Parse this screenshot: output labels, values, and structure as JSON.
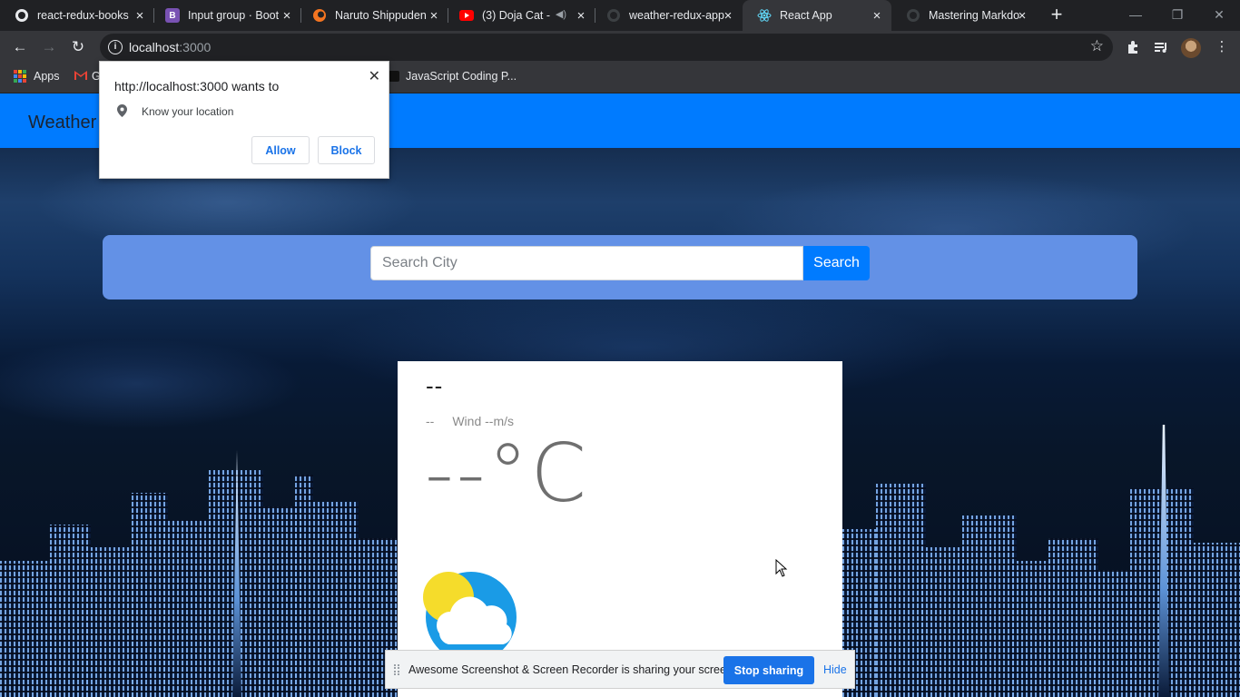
{
  "browser": {
    "tabs": [
      {
        "title": "react-redux-books",
        "icon": "github-icon"
      },
      {
        "title": "Input group · Boot",
        "icon": "bootstrap-icon"
      },
      {
        "title": "Naruto Shippuden",
        "icon": "crunchyroll-icon"
      },
      {
        "title": "(3) Doja Cat - ",
        "icon": "youtube-icon"
      },
      {
        "title": "weather-redux-app",
        "icon": "github-icon"
      },
      {
        "title": "React App",
        "icon": "react-icon",
        "active": true
      },
      {
        "title": "Mastering Markdo",
        "icon": "github-icon"
      }
    ],
    "address": {
      "host": "localhost",
      "port": ":3000"
    },
    "bookmarks": {
      "apps": "Apps",
      "gmail": "G",
      "javascript": "JavaScript Coding P..."
    }
  },
  "permission": {
    "title": "http://localhost:3000 wants to",
    "request": "Know your location",
    "allow": "Allow",
    "block": "Block"
  },
  "app": {
    "brand": "Weather",
    "search": {
      "placeholder": "Search City",
      "button": "Search"
    },
    "card": {
      "city": "--",
      "description": "--",
      "wind": "Wind --m/s",
      "temperature": "--°C",
      "icon": "partly-cloudy-icon"
    }
  },
  "sharing": {
    "message": "Awesome Screenshot & Screen Recorder is sharing your screen.",
    "stop": "Stop sharing",
    "hide": "Hide"
  },
  "colors": {
    "navbar": "#007bff",
    "searchbar": "#6391e6",
    "chrome_dark": "#202124",
    "chrome_toolbar": "#35363a",
    "link_blue": "#1a73e8"
  }
}
